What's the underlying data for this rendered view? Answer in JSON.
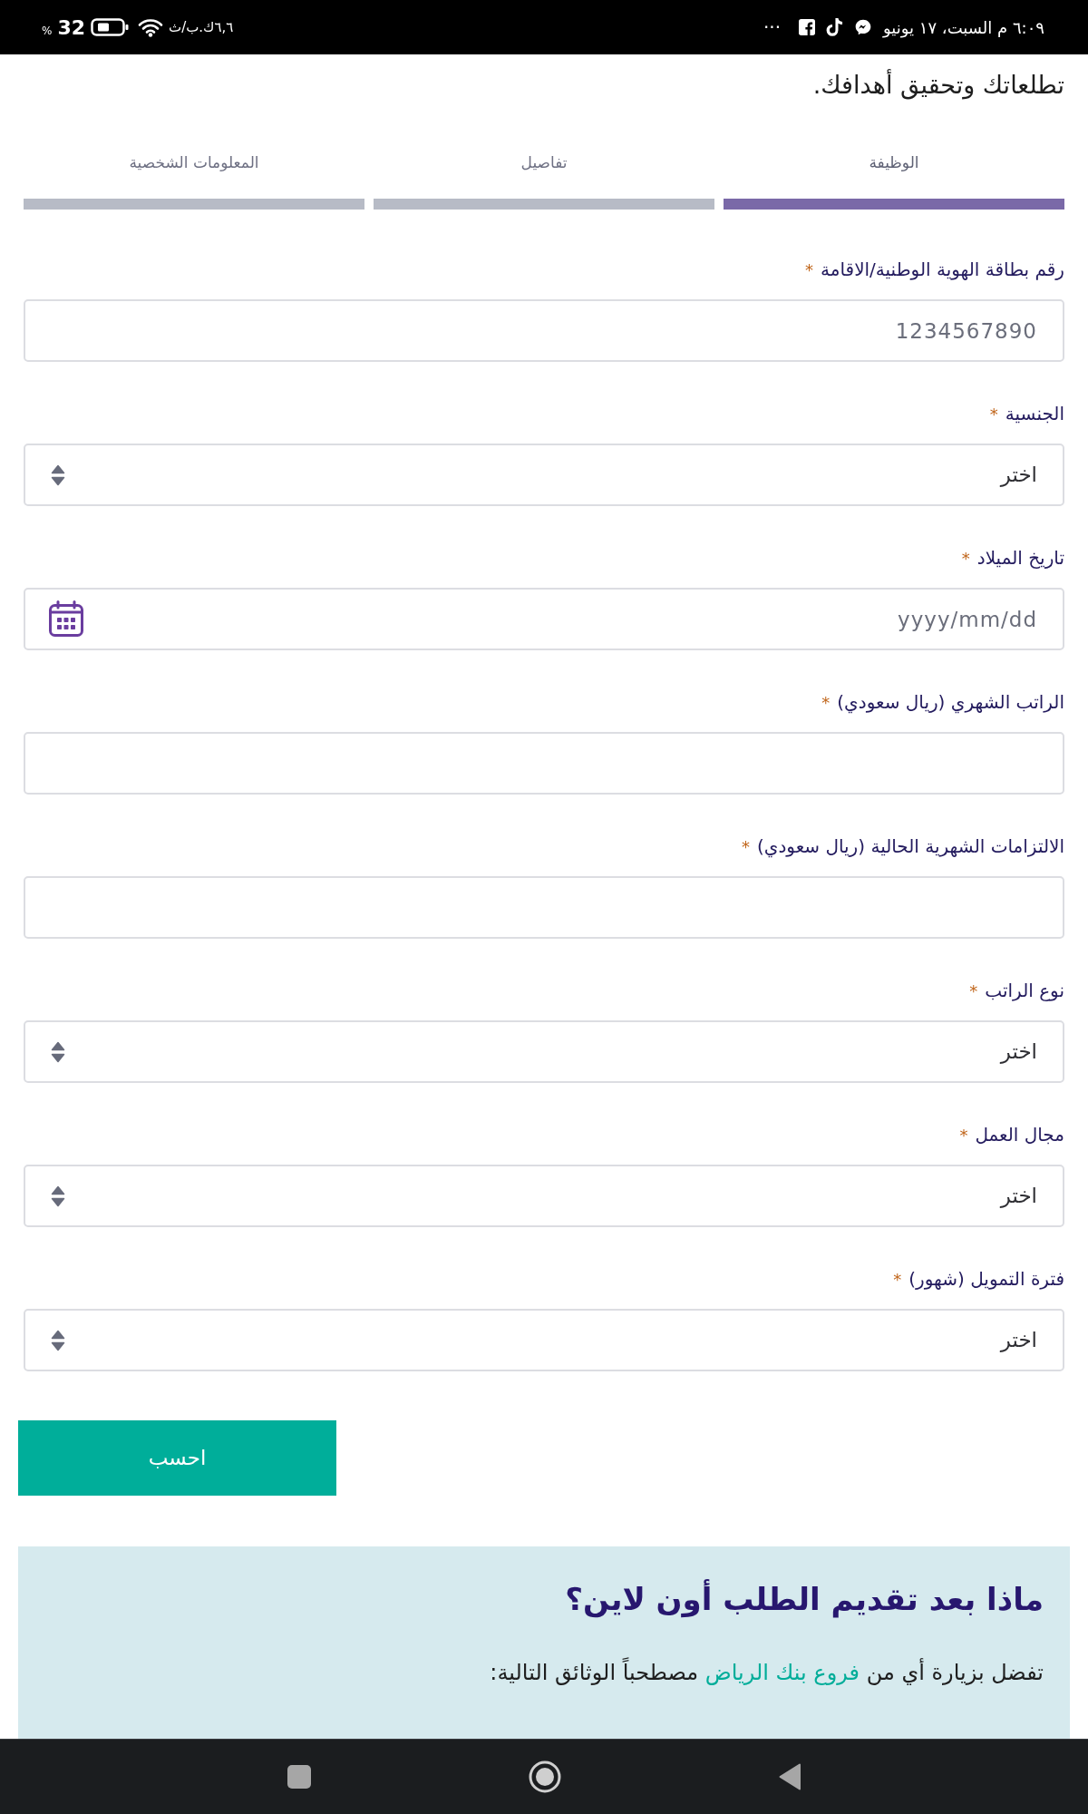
{
  "status_bar": {
    "clock": "٦:٠٩ م السبت، ١٧ يونيو",
    "more_notifications": "···",
    "network_speed": "٦,٦ك.ب/ث",
    "battery_percent": "32",
    "percent_sign": "%"
  },
  "intro_text": "تطلعاتك وتحقيق أهدافك.",
  "steps": [
    {
      "label": "الوظيفة",
      "selected": true
    },
    {
      "label": "تفاصيل",
      "selected": false
    },
    {
      "label": "المعلومات الشخصية",
      "selected": false
    }
  ],
  "fields": [
    {
      "kind": "text",
      "label": "رقم بطاقة الهوية الوطنية/الاقامة",
      "required_mark": "*",
      "placeholder": "1234567890"
    },
    {
      "kind": "select",
      "label": "الجنسية",
      "required_mark": "*",
      "value": "اختر"
    },
    {
      "kind": "date",
      "label": "تاريخ الميلاد",
      "required_mark": "*",
      "placeholder": "yyyy/mm/dd"
    },
    {
      "kind": "text",
      "label": "الراتب الشهري (ريال سعودي)",
      "required_mark": "*"
    },
    {
      "kind": "text",
      "label": "الالتزامات الشهرية الحالية (ريال سعودي)",
      "required_mark": "*"
    },
    {
      "kind": "select",
      "label": "نوع الراتب",
      "required_mark": "*",
      "value": "اختر"
    },
    {
      "kind": "select",
      "label": "مجال العمل",
      "required_mark": "*",
      "value": "اختر"
    },
    {
      "kind": "select",
      "label": "فترة التمويل (شهور)",
      "required_mark": "*",
      "value": "اختر"
    }
  ],
  "calculate_button": "احسب",
  "info_panel": {
    "heading": "ماذا بعد تقديم الطلب أون لاين؟",
    "paragraph": {
      "before": "تفضل بزيارة أي من",
      "link": "فروع بنك الرياض",
      "after": "مصطحباً الوثائق التالية:"
    }
  }
}
